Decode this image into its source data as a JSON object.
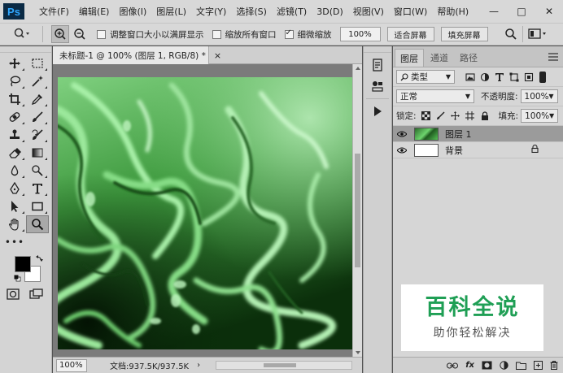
{
  "app": {
    "logo": "Ps",
    "menu": [
      "文件(F)",
      "编辑(E)",
      "图像(I)",
      "图层(L)",
      "文字(Y)",
      "选择(S)",
      "滤镜(T)",
      "3D(D)",
      "视图(V)",
      "窗口(W)",
      "帮助(H)"
    ],
    "window_controls": [
      "—",
      "□",
      "✕"
    ]
  },
  "options_bar": {
    "resize_windows_label": "调整窗口大小以满屏显示",
    "resize_windows_checked": false,
    "zoom_all_label": "缩放所有窗口",
    "zoom_all_checked": false,
    "scrubby_label": "细微缩放",
    "scrubby_checked": true,
    "zoom_value": "100%",
    "fit_screen": "适合屏幕",
    "fill_screen": "填充屏幕"
  },
  "document": {
    "tab_title": "未标题-1 @ 100% (图层 1, RGB/8) *",
    "close": "×",
    "status_zoom": "100%",
    "status_info": "文档:937.5K/937.5K",
    "status_arrow": "›"
  },
  "toolbar": {
    "more": "•••",
    "foreground_color": "#000000",
    "background_color": "#ffffff",
    "active_tool": "zoom-tool"
  },
  "layers_panel": {
    "tabs": [
      "图层",
      "通道",
      "路径"
    ],
    "active_tab": "图层",
    "filter_kind": "类型",
    "blend_mode": "正常",
    "opacity_label": "不透明度:",
    "opacity_value": "100%",
    "lock_label": "锁定:",
    "fill_label": "填充:",
    "fill_value": "100%",
    "layers": [
      {
        "name": "图层 1",
        "selected": true,
        "thumb": "green",
        "locked": false
      },
      {
        "name": "背景",
        "selected": false,
        "thumb": "white",
        "locked": true
      }
    ],
    "bottom_icons": [
      "link-icon",
      "fx-icon",
      "mask-icon",
      "adjustment-icon",
      "group-icon",
      "new-layer-icon",
      "trash-icon"
    ],
    "fx_label": "fx"
  },
  "watermark": {
    "title": "百科全说",
    "subtitle": "助你轻松解决"
  },
  "colors": {
    "accent_green": "#1f9f55",
    "ps_logo_bg": "#0a2a45",
    "ps_logo_fg": "#31a8ff"
  }
}
